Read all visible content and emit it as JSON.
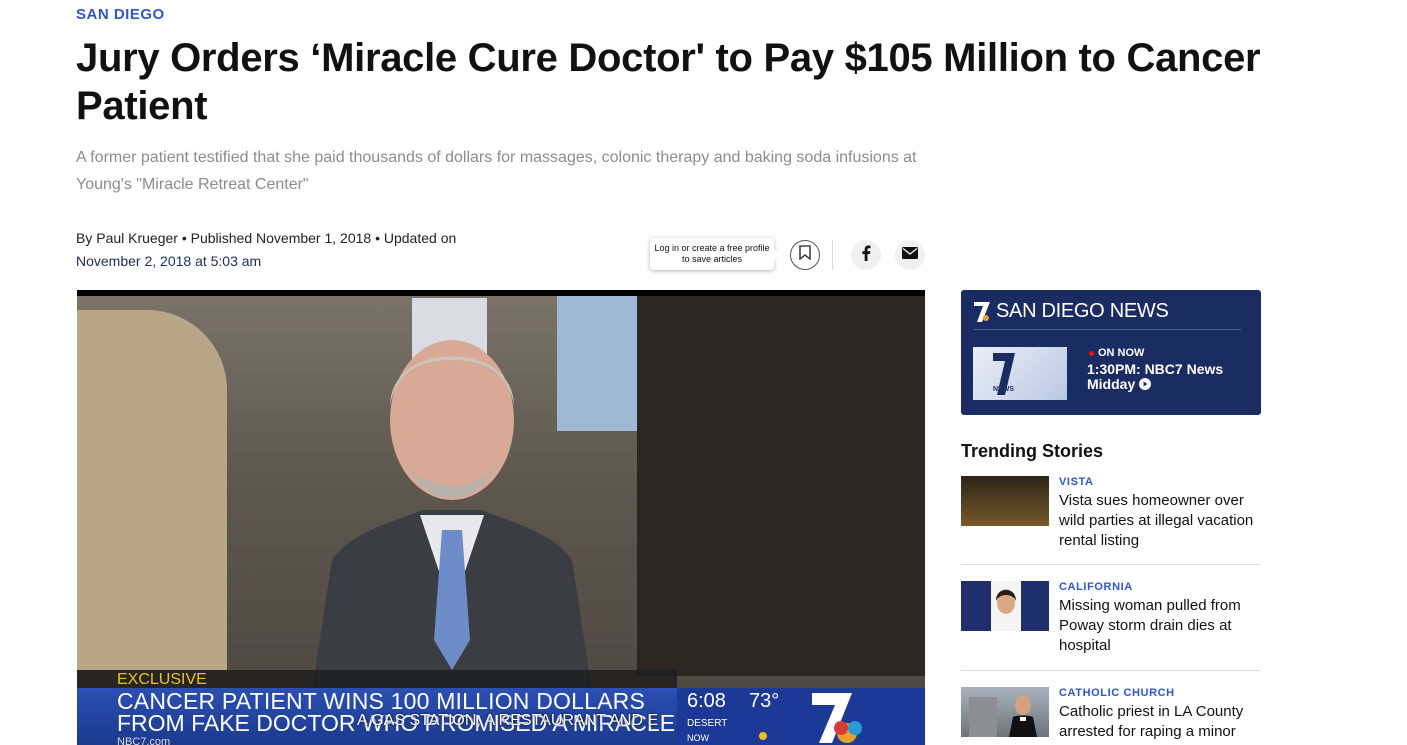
{
  "article": {
    "kicker": "SAN DIEGO",
    "headline": "Jury Orders ‘Miracle Cure Doctor' to Pay $105 Million to Cancer Patient",
    "dek": "A former patient testified that she paid thousands of dollars for massages, colonic therapy and baking soda infusions at Young's \"Miracle Retreat Center\"",
    "byline_prefix": "By ",
    "author": "Paul Krueger",
    "published": " • Published November 1, 2018 • Updated on",
    "updated": "November 2, 2018 at 5:03 am"
  },
  "share": {
    "tooltip": "Log in or create a free profile to save articles",
    "bookmark_icon": "bookmark-icon",
    "facebook_icon": "facebook-icon",
    "email_icon": "email-icon"
  },
  "video": {
    "exclusive_label": "EXCLUSIVE",
    "lower_third_line1": "CANCER PATIENT WINS 100 MILLION DOLLARS",
    "lower_third_line2": "FROM FAKE DOCTOR WHO PROMISED A MIRACLE CURE",
    "crawl": "A GAS STATION, A RESTAURANT AND E",
    "url": "NBC7.com",
    "time": "6:08",
    "temp": "73°",
    "location": "DESERT",
    "now": "NOW"
  },
  "sidebar": {
    "live": {
      "logo_text": "7",
      "brand": "SAN DIEGO NEWS",
      "on_now": "ON NOW",
      "show": "1:30PM: NBC7 News Midday"
    },
    "trending_title": "Trending Stories",
    "stories": [
      {
        "category": "VISTA",
        "title": "Vista sues homeowner over wild parties at illegal vacation rental listing"
      },
      {
        "category": "CALIFORNIA",
        "title": "Missing woman pulled from Poway storm drain dies at hospital"
      },
      {
        "category": "CATHOLIC CHURCH",
        "title": "Catholic priest in LA County arrested for raping a minor"
      }
    ]
  },
  "colors": {
    "accent": "#2f57c6",
    "navy": "#1b2c63"
  }
}
